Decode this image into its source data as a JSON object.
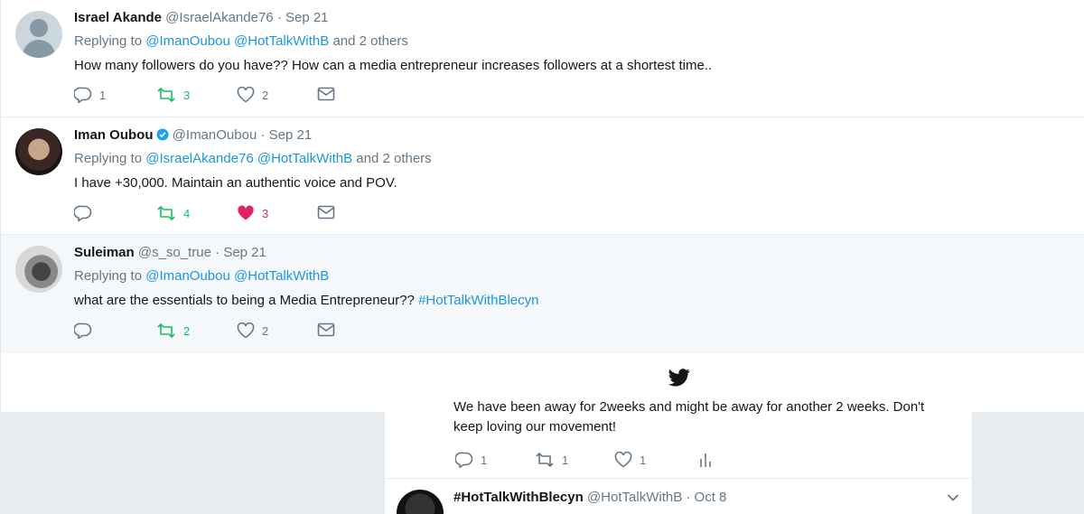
{
  "tweets": [
    {
      "name": "Israel Akande",
      "handle": "@IsraelAkande76",
      "time": "Sep 21",
      "replying_prefix": "Replying to",
      "mention1": "@ImanOubou",
      "mention2": "@HotTalkWithB",
      "replying_suffix": "and 2 others",
      "text": "How many followers do you have?? How can a media entrepreneur increases followers at a shortest time..",
      "replies": "1",
      "retweets": "3",
      "likes": "2"
    },
    {
      "name": "Iman Oubou",
      "handle": "@ImanOubou",
      "time": "Sep 21",
      "replying_prefix": "Replying to",
      "mention1": "@IsraelAkande76",
      "mention2": "@HotTalkWithB",
      "replying_suffix": "and 2 others",
      "text": "I have +30,000. Maintain an authentic voice and POV.",
      "replies": "",
      "retweets": "4",
      "likes": "3"
    },
    {
      "name": "Suleiman",
      "handle": "@s_so_true",
      "time": "Sep 21",
      "replying_prefix": "Replying to",
      "mention1": "@ImanOubou",
      "mention2": "@HotTalkWithB",
      "text": "what are the essentials to being a Media Entrepreneur??",
      "hashtag": "#HotTalkWithBlecyn",
      "replies": "",
      "retweets": "2",
      "likes": "2"
    }
  ],
  "separator": "·",
  "under": {
    "line1": "We have been away for 2weeks and might  be away for another 2 weeks. Don't",
    "line2": "keep loving our movement!",
    "replies": "1",
    "retweets": "1",
    "likes": "1",
    "next_name": "#HotTalkWithBlecyn",
    "next_handle": "@HotTalkWithB",
    "next_time": "Oct 8"
  },
  "colors": {
    "link": "#1b95e0",
    "retweet": "#17bf63",
    "like": "#e0245e",
    "verified": "#1da1f2"
  }
}
